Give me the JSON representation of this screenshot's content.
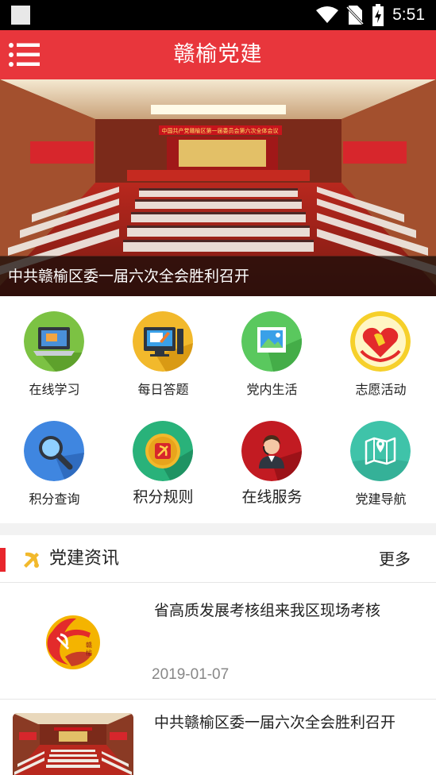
{
  "status_bar": {
    "time": "5:51"
  },
  "app_bar": {
    "title": "赣榆党建",
    "menu_icon": "menu-icon"
  },
  "banner": {
    "caption": "中共赣榆区委一届六次全会胜利召开",
    "hall_banner_text": "中国共产党赣榆区第一届委员会第六次全体会议",
    "dots_count": 5,
    "active_dot": 0
  },
  "grid": {
    "items": [
      {
        "label": "在线学习",
        "icon": "laptop-icon",
        "color": "#7cc243"
      },
      {
        "label": "每日答题",
        "icon": "monitor-icon",
        "color": "#f2b92c"
      },
      {
        "label": "党内生活",
        "icon": "picture-icon",
        "color": "#5ac85e"
      },
      {
        "label": "志愿活动",
        "icon": "volunteer-heart-icon",
        "color": "#f6d02a"
      },
      {
        "label": "积分查询",
        "icon": "magnifier-icon",
        "color": "#3f86e0"
      },
      {
        "label": "积分规则",
        "icon": "party-emblem-icon",
        "color": "#29b27a"
      },
      {
        "label": "在线服务",
        "icon": "customer-service-icon",
        "color": "#c21b22"
      },
      {
        "label": "党建导航",
        "icon": "map-icon",
        "color": "#3fc3a9"
      }
    ]
  },
  "news": {
    "header_title": "党建资讯",
    "more_label": "更多",
    "items": [
      {
        "title": "省高质发展考核组来我区现场考核",
        "date": "2019-01-07"
      },
      {
        "title": "中共赣榆区委一届六次全会胜利召开",
        "date": ""
      }
    ]
  },
  "colors": {
    "primary_red": "#e8363c",
    "accent_red": "#e8262c"
  }
}
